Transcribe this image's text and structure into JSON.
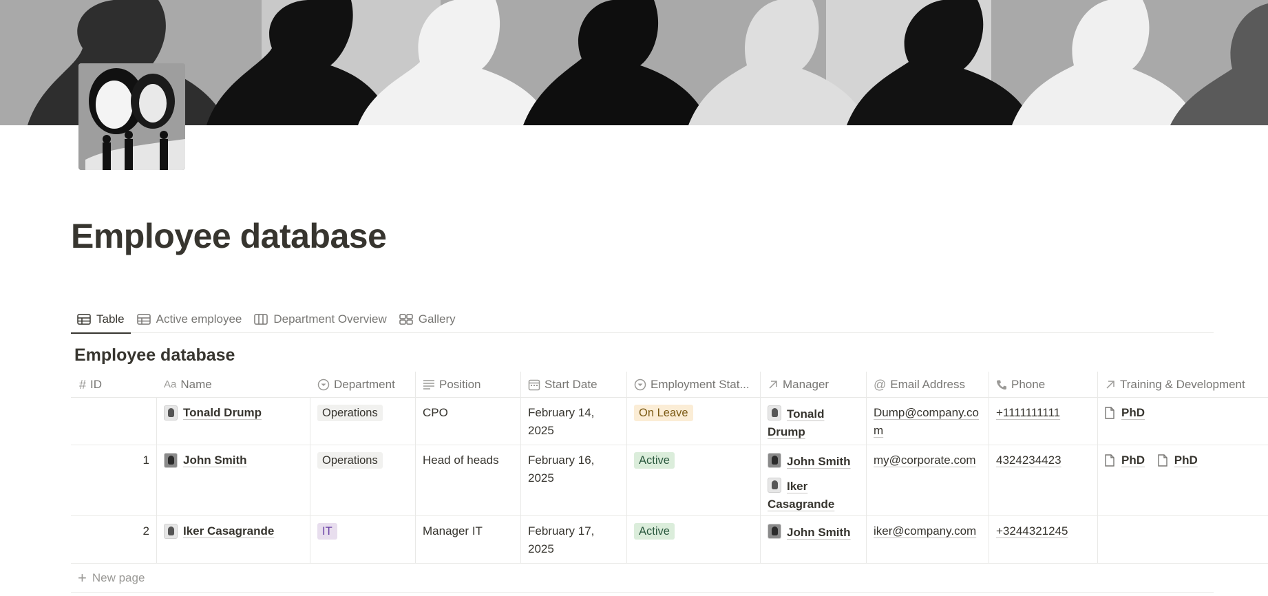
{
  "page": {
    "title": "Employee database"
  },
  "tabs": [
    {
      "label": "Table",
      "icon": "table-icon",
      "active": true
    },
    {
      "label": "Active employee",
      "icon": "table-icon",
      "active": false
    },
    {
      "label": "Department Overview",
      "icon": "board-icon",
      "active": false
    },
    {
      "label": "Gallery",
      "icon": "gallery-icon",
      "active": false
    }
  ],
  "database": {
    "title": "Employee database",
    "columns": {
      "id": "ID",
      "name": "Name",
      "department": "Department",
      "position": "Position",
      "start_date": "Start Date",
      "status": "Employment Stat...",
      "manager": "Manager",
      "email": "Email Address",
      "phone": "Phone",
      "training": "Training & Development"
    },
    "rows": [
      {
        "id": "",
        "name": "Tonald Drump",
        "department": "Operations",
        "position": "CPO",
        "start_date": "February 14, 2025",
        "status": "On Leave",
        "managers": [
          "Tonald Drump"
        ],
        "email": "Dump@company.com",
        "phone": "+1111111111",
        "training": [
          "PhD"
        ]
      },
      {
        "id": "1",
        "name": "John Smith",
        "department": "Operations",
        "position": "Head of heads",
        "start_date": "February 16, 2025",
        "status": "Active",
        "managers": [
          "John Smith",
          "Iker Casagrande"
        ],
        "email": "my@corporate.com",
        "phone": "4324234423",
        "training": [
          "PhD",
          "PhD"
        ]
      },
      {
        "id": "2",
        "name": "Iker Casagrande",
        "department": "IT",
        "position": "Manager IT",
        "start_date": "February 17, 2025",
        "status": "Active",
        "managers": [
          "John Smith"
        ],
        "email": "iker@company.com",
        "phone": "+3244321245",
        "training": []
      }
    ],
    "new_page_label": "New page"
  },
  "colors": {
    "text": "#37352f",
    "muted": "#787774",
    "tag_operations": "#f1f1ef",
    "tag_it": "#e8deee",
    "tag_on_leave": "#fbedd6",
    "tag_active": "#dbeddb"
  }
}
